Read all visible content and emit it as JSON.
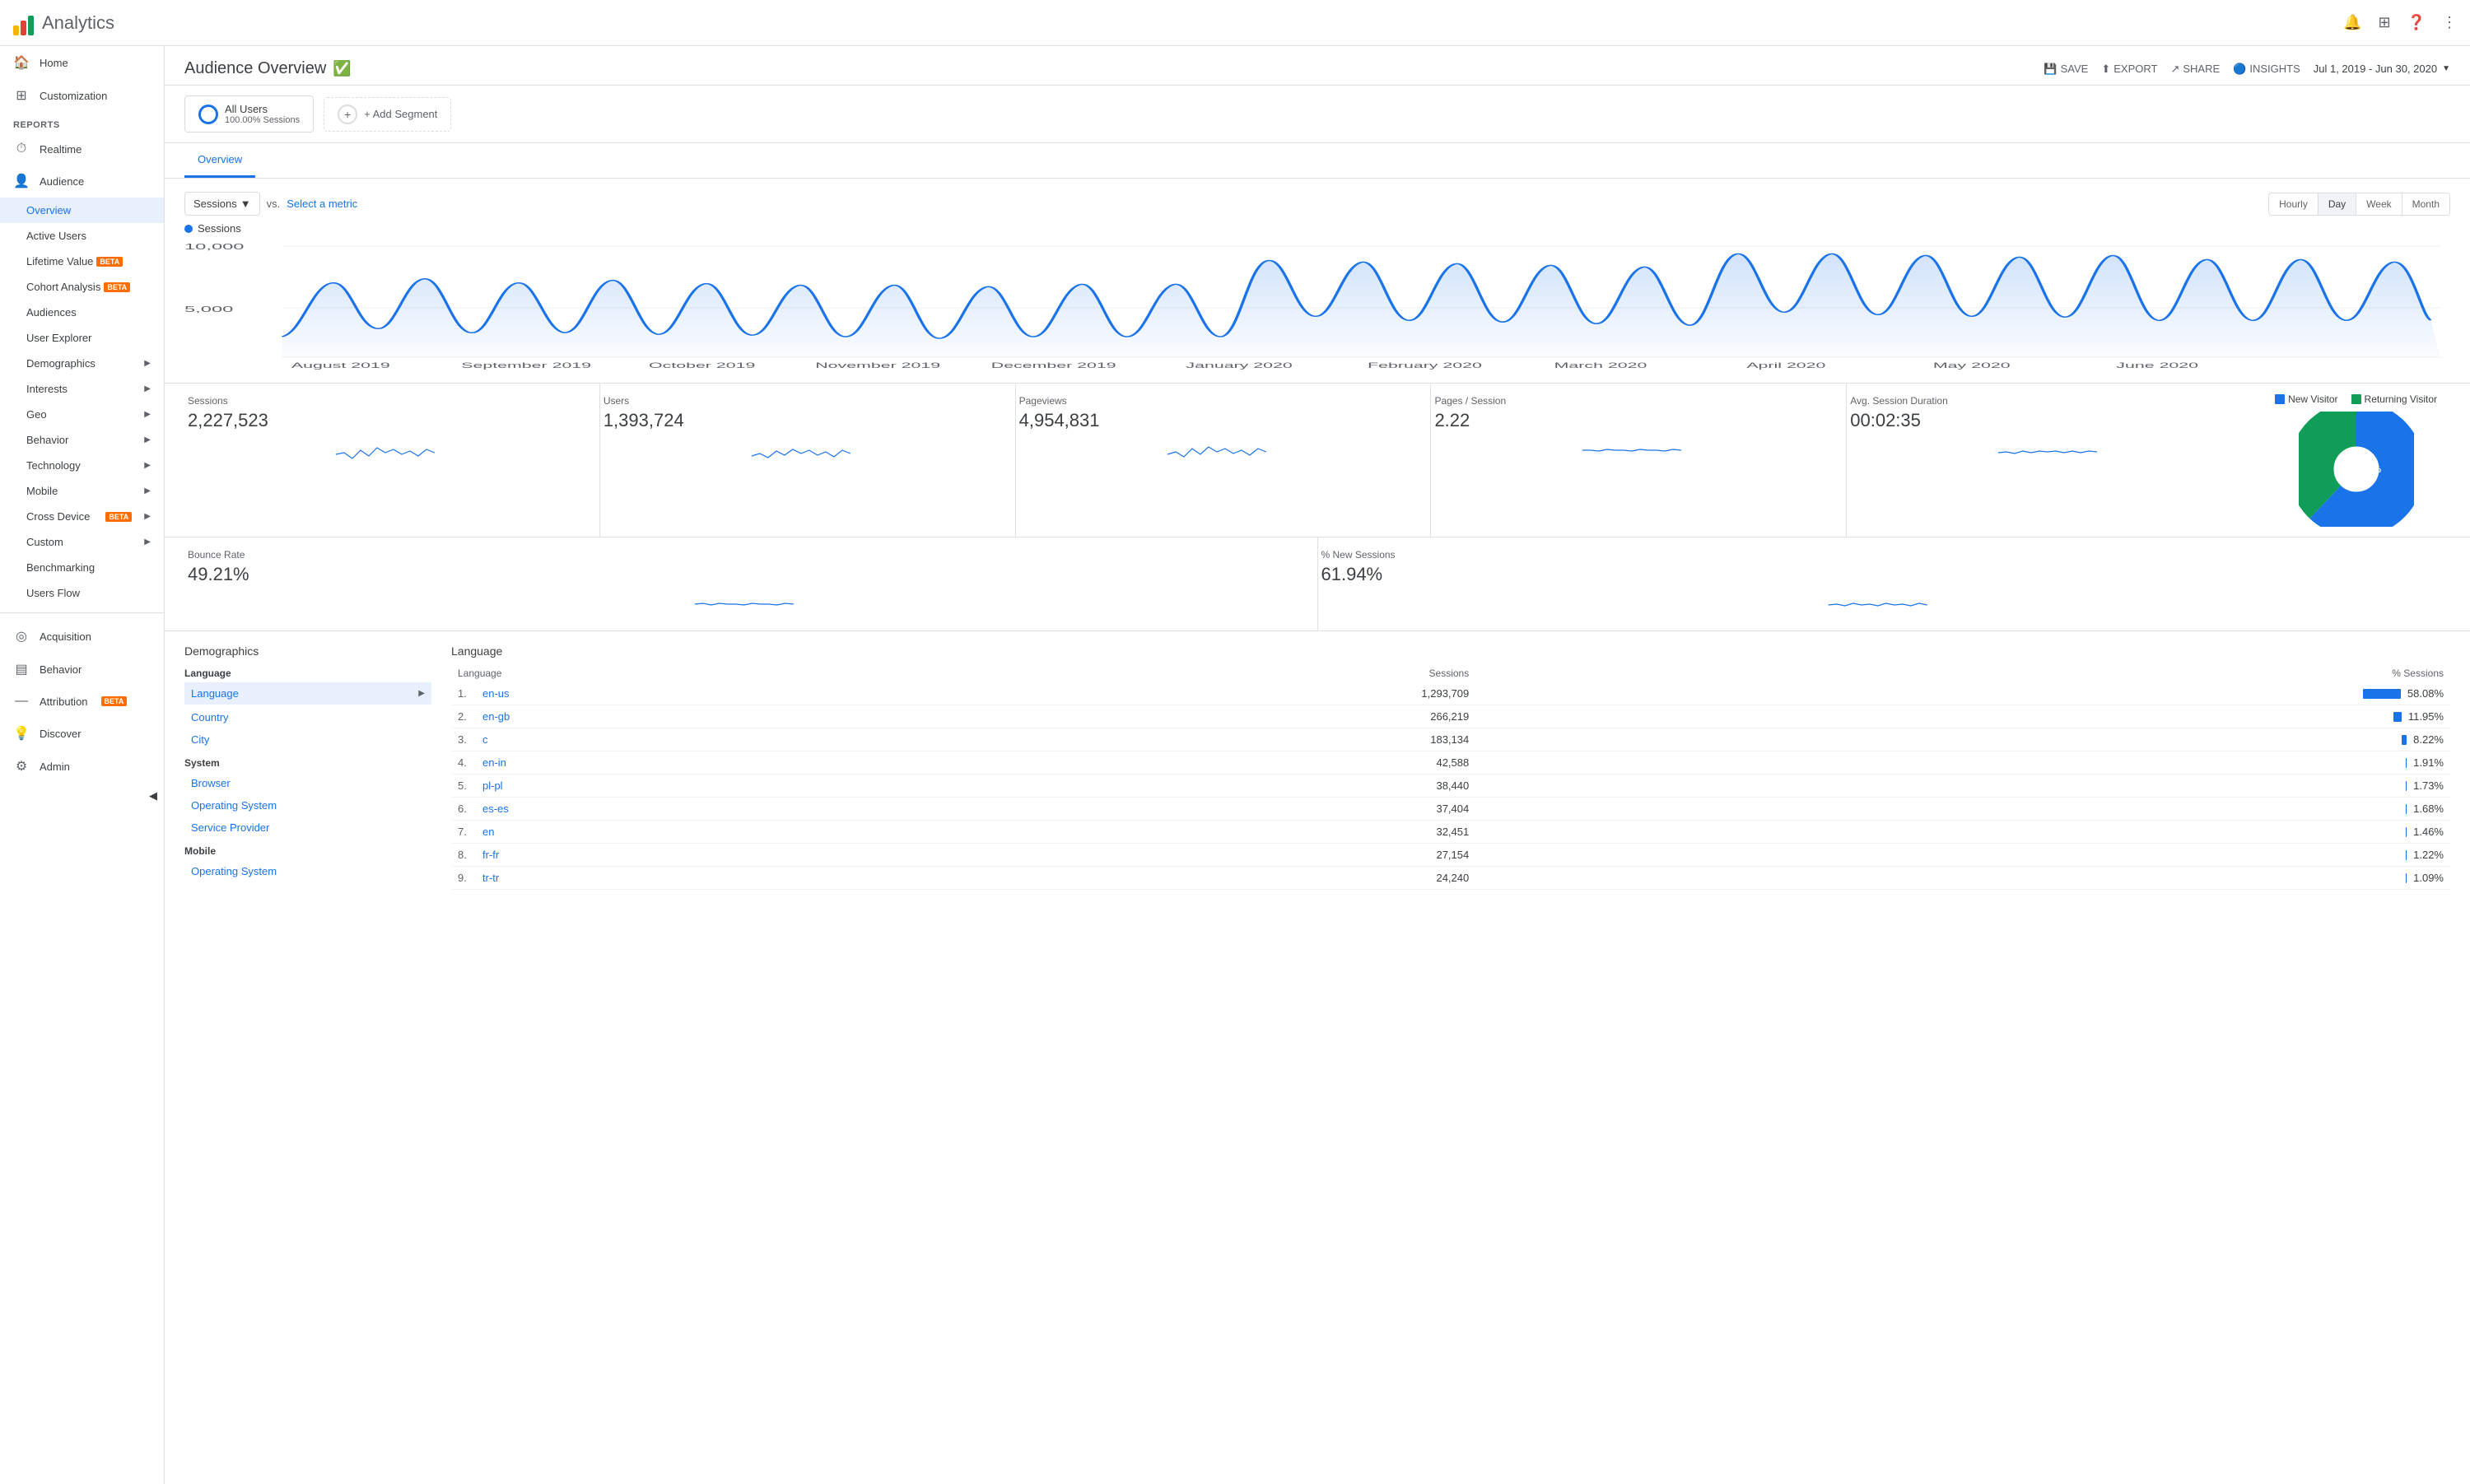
{
  "topbar": {
    "title": "Analytics",
    "logo_bars": [
      "yellow",
      "red",
      "green"
    ]
  },
  "sidebar": {
    "items": [
      {
        "label": "Home",
        "icon": "🏠"
      },
      {
        "label": "Customization",
        "icon": "⊞"
      }
    ],
    "section_label": "REPORTS",
    "report_items": [
      {
        "label": "Realtime",
        "icon": "⏱",
        "expandable": true
      },
      {
        "label": "Audience",
        "icon": "👤",
        "expandable": true,
        "active": true
      }
    ],
    "audience_sub": [
      {
        "label": "Overview",
        "active": true
      },
      {
        "label": "Active Users"
      },
      {
        "label": "Lifetime Value",
        "beta": true
      },
      {
        "label": "Cohort Analysis",
        "beta": true
      },
      {
        "label": "Audiences"
      },
      {
        "label": "User Explorer"
      }
    ],
    "audience_expandable": [
      {
        "label": "Demographics"
      },
      {
        "label": "Interests"
      },
      {
        "label": "Geo"
      },
      {
        "label": "Behavior"
      },
      {
        "label": "Technology"
      },
      {
        "label": "Mobile"
      },
      {
        "label": "Cross Device",
        "beta": true
      },
      {
        "label": "Custom"
      }
    ],
    "more_items": [
      {
        "label": "Benchmarking"
      },
      {
        "label": "Users Flow"
      }
    ],
    "bottom_nav": [
      {
        "label": "Acquisition",
        "icon": "◎"
      },
      {
        "label": "Behavior",
        "icon": "▤"
      },
      {
        "label": "Attribution",
        "icon": "—",
        "beta": true
      },
      {
        "label": "Discover",
        "icon": "💡"
      },
      {
        "label": "Admin",
        "icon": "⚙"
      }
    ]
  },
  "page": {
    "title": "Audience Overview",
    "verified": true,
    "actions": {
      "save": "SAVE",
      "export": "EXPORT",
      "share": "SHARE",
      "insights": "INSIGHTS"
    },
    "date_range": "Jul 1, 2019 - Jun 30, 2020"
  },
  "segments": {
    "all_users": "All Users",
    "all_users_sub": "100.00% Sessions",
    "add_segment": "+ Add Segment"
  },
  "tabs": [
    {
      "label": "Overview",
      "active": true
    }
  ],
  "chart": {
    "metric_label": "Sessions",
    "vs_label": "vs.",
    "select_metric": "Select a metric",
    "time_buttons": [
      "Hourly",
      "Day",
      "Week",
      "Month"
    ],
    "active_time": "Day",
    "y_labels": [
      "10,000",
      "5,000"
    ],
    "x_labels": [
      "August 2019",
      "September 2019",
      "October 2019",
      "November 2019",
      "December 2019",
      "January 2020",
      "February 2020",
      "March 2020",
      "April 2020",
      "May 2020",
      "June 2020"
    ]
  },
  "metrics": [
    {
      "label": "Sessions",
      "value": "2,227,523"
    },
    {
      "label": "Users",
      "value": "1,393,724"
    },
    {
      "label": "Pageviews",
      "value": "4,954,831"
    },
    {
      "label": "Pages / Session",
      "value": "2.22"
    },
    {
      "label": "Avg. Session Duration",
      "value": "00:02:35"
    }
  ],
  "metrics_row2": [
    {
      "label": "Bounce Rate",
      "value": "49.21%"
    },
    {
      "label": "% New Sessions",
      "value": "61.94%"
    }
  ],
  "pie_chart": {
    "legend": [
      {
        "label": "New Visitor",
        "color": "#1a73e8",
        "pct": 62
      },
      {
        "label": "Returning Visitor",
        "color": "#0f9d58",
        "pct": 38
      }
    ]
  },
  "demographics": {
    "title": "Demographics",
    "categories": [
      {
        "name": "Language",
        "links": [
          "Language"
        ],
        "active_link": "Language",
        "sub_links": [
          "Country",
          "City"
        ]
      },
      {
        "name": "System",
        "links": [
          "Browser",
          "Operating System",
          "Service Provider"
        ]
      },
      {
        "name": "Mobile",
        "links": [
          "Operating System"
        ]
      }
    ]
  },
  "language_table": {
    "title": "Language",
    "headers": [
      "",
      "Sessions",
      "% Sessions"
    ],
    "rows": [
      {
        "rank": "1.",
        "lang": "en-us",
        "sessions": "1,293,709",
        "pct": "58.08%",
        "bar": 58
      },
      {
        "rank": "2.",
        "lang": "en-gb",
        "sessions": "266,219",
        "pct": "11.95%",
        "bar": 12
      },
      {
        "rank": "3.",
        "lang": "c",
        "sessions": "183,134",
        "pct": "8.22%",
        "bar": 8
      },
      {
        "rank": "4.",
        "lang": "en-in",
        "sessions": "42,588",
        "pct": "1.91%",
        "bar": 2
      },
      {
        "rank": "5.",
        "lang": "pl-pl",
        "sessions": "38,440",
        "pct": "1.73%",
        "bar": 2
      },
      {
        "rank": "6.",
        "lang": "es-es",
        "sessions": "37,404",
        "pct": "1.68%",
        "bar": 2
      },
      {
        "rank": "7.",
        "lang": "en",
        "sessions": "32,451",
        "pct": "1.46%",
        "bar": 1
      },
      {
        "rank": "8.",
        "lang": "fr-fr",
        "sessions": "27,154",
        "pct": "1.22%",
        "bar": 1
      },
      {
        "rank": "9.",
        "lang": "tr-tr",
        "sessions": "24,240",
        "pct": "1.09%",
        "bar": 1
      }
    ]
  }
}
